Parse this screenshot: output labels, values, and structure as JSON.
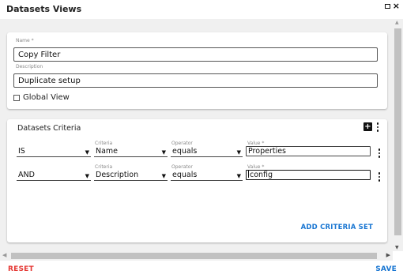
{
  "dialog": {
    "title": "Datasets Views",
    "maximize_icon": "maximize-icon",
    "close_symbol": "×"
  },
  "info": {
    "name_label": "Name *",
    "name_value": "Copy Filter",
    "description_label": "Description",
    "description_value": "Duplicate setup",
    "global_view_label": "Global View",
    "global_view_checked": false
  },
  "criteria": {
    "heading": "Datasets Criteria",
    "add_icon": "plus-square-icon",
    "menu_icon": "kebab-menu-icon",
    "rows": [
      {
        "logic": "IS",
        "criteria_label": "Criteria",
        "criteria": "Name",
        "operator_label": "Operator",
        "operator": "equals",
        "value_label": "Value *",
        "value": "Properties"
      },
      {
        "logic": "AND",
        "criteria_label": "Criteria",
        "criteria": "Description",
        "operator_label": "Operator",
        "operator": "equals",
        "value_label": "Value *",
        "value": "config"
      }
    ],
    "add_set_label": "ADD CRITERIA SET"
  },
  "footer": {
    "reset_label": "RESET",
    "save_label": "SAVE"
  },
  "colors": {
    "accent": "#1976d2",
    "danger": "#e53935"
  }
}
